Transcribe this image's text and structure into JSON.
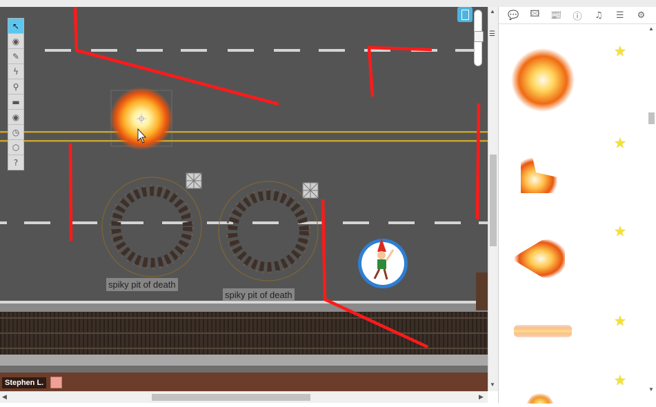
{
  "toolbar": {
    "tools": [
      {
        "name": "select-tool",
        "icon": "pointer-icon",
        "glyph": "↖",
        "active": true
      },
      {
        "name": "layers-tool",
        "icon": "eye-icon",
        "glyph": "◉",
        "active": false
      },
      {
        "name": "draw-tool",
        "icon": "pencil-icon",
        "glyph": "✎",
        "active": false
      },
      {
        "name": "fx-tool",
        "icon": "lightning-icon",
        "glyph": "ϟ",
        "active": false
      },
      {
        "name": "zoom-tool",
        "icon": "magnifier-icon",
        "glyph": "⚲",
        "active": false
      },
      {
        "name": "measure-tool",
        "icon": "ruler-icon",
        "glyph": "▬",
        "active": false
      },
      {
        "name": "fog-tool",
        "icon": "eye-icon",
        "glyph": "◉",
        "active": false
      },
      {
        "name": "turn-tracker-tool",
        "icon": "clock-icon",
        "glyph": "◷",
        "active": false
      },
      {
        "name": "dice-tool",
        "icon": "d20-icon",
        "glyph": "⬡",
        "active": false
      },
      {
        "name": "help-tool",
        "icon": "help-icon",
        "glyph": "?",
        "active": false
      }
    ]
  },
  "map": {
    "pits": [
      {
        "label": "spiky pit of death"
      },
      {
        "label": "spiky pit of death"
      }
    ],
    "token": {
      "name": "gnome-token",
      "ring_color": "#2e7fd1"
    },
    "wall_color": "#ff1a1a",
    "road_line_color": "#c9a32a",
    "lane_dash_color": "#e8e8e8"
  },
  "player": {
    "name": "Stephen L.",
    "color": "#f0a095"
  },
  "sidebar": {
    "tabs": [
      {
        "name": "chat-tab",
        "icon": "chat-icon",
        "glyph": "💬"
      },
      {
        "name": "art-library-tab",
        "icon": "image-icon",
        "glyph": "🖾"
      },
      {
        "name": "journal-tab",
        "icon": "journal-icon",
        "glyph": "📰"
      },
      {
        "name": "compendium-tab",
        "icon": "info-icon",
        "glyph": "ⓘ"
      },
      {
        "name": "jukebox-tab",
        "icon": "music-icon",
        "glyph": "♫"
      },
      {
        "name": "decks-tab",
        "icon": "list-icon",
        "glyph": "☰"
      },
      {
        "name": "settings-tab",
        "icon": "gear-icon",
        "glyph": "⚙"
      }
    ],
    "fx_items": [
      {
        "name": "fx-burst",
        "icon": "fire-burst-icon",
        "star": "★"
      },
      {
        "name": "fx-corner",
        "icon": "fire-corner-icon",
        "star": "★"
      },
      {
        "name": "fx-cone",
        "icon": "fire-cone-icon",
        "star": "★"
      },
      {
        "name": "fx-beam",
        "icon": "fire-beam-icon",
        "star": "★"
      },
      {
        "name": "fx-partial",
        "icon": "fire-partial-icon",
        "star": "★"
      }
    ]
  }
}
